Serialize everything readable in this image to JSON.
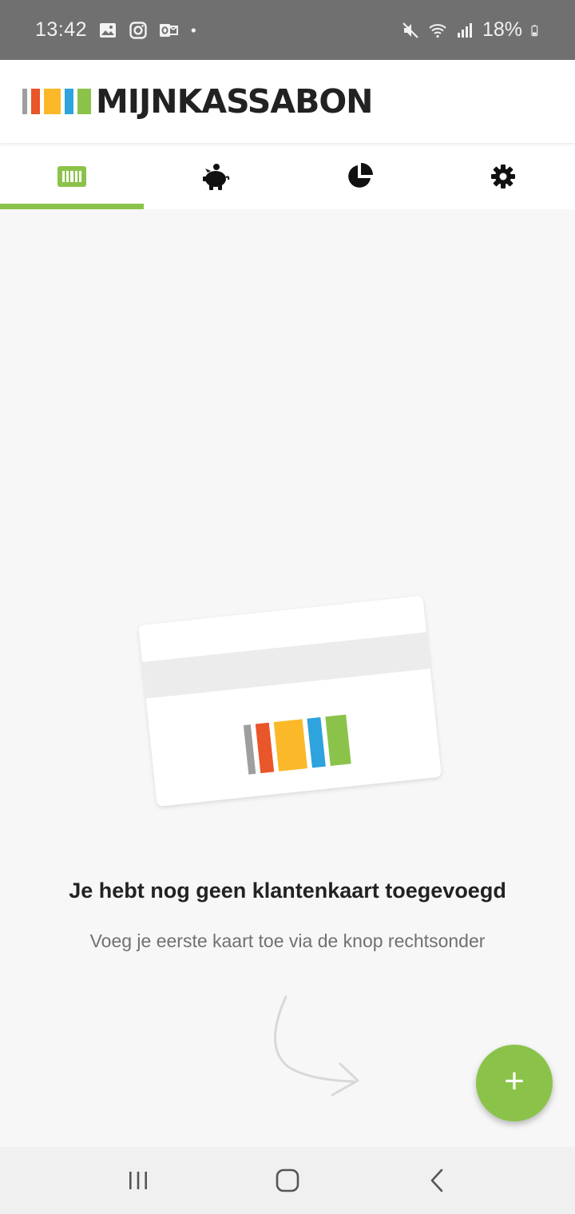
{
  "status_bar": {
    "time": "13:42",
    "battery": "18%",
    "icons": [
      "gallery-icon",
      "instagram-icon",
      "outlook-icon",
      "dot-icon",
      "mute-icon",
      "wifi-icon",
      "signal-icon",
      "battery-icon"
    ]
  },
  "header": {
    "logo_text": "MIJNKASSABON",
    "logo_colors": [
      "#9e9e9e",
      "#e8562a",
      "#fbb829",
      "#2ea3de",
      "#8bc34a"
    ]
  },
  "tabs": [
    {
      "name": "tab-cards",
      "icon": "barcode-card-icon",
      "active": true
    },
    {
      "name": "tab-savings",
      "icon": "piggy-bank-icon",
      "active": false
    },
    {
      "name": "tab-stats",
      "icon": "pie-chart-icon",
      "active": false
    },
    {
      "name": "tab-settings",
      "icon": "gear-icon",
      "active": false
    }
  ],
  "empty_state": {
    "title": "Je hebt nog geen klantenkaart toegevoegd",
    "subtitle": "Voeg je eerste kaart toe via de knop rechtsonder"
  },
  "fab": {
    "label": "+",
    "icon": "plus-icon"
  },
  "nav_bar": {
    "icons": [
      "recent-apps-icon",
      "home-icon",
      "back-icon"
    ]
  },
  "colors": {
    "accent": "#8bc34a",
    "status_bar": "#707070"
  }
}
